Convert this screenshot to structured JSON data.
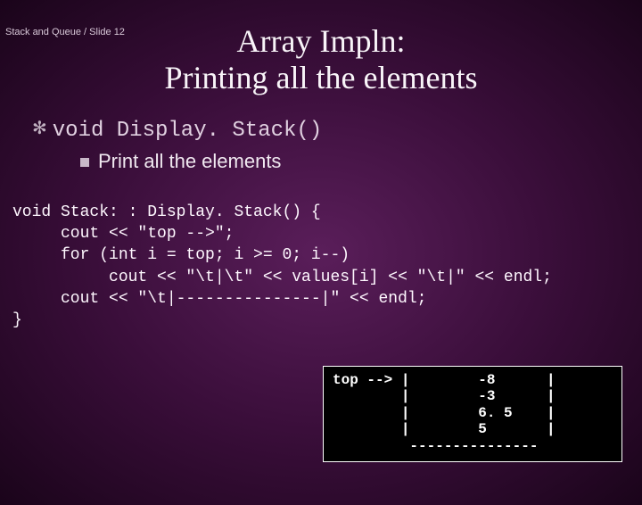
{
  "breadcrumb": "Stack and Queue / Slide 12",
  "title_line1": "Array Impln:",
  "title_line2": "Printing all the elements",
  "bullet": {
    "keyword": "void",
    "signature": " Display. Stack()"
  },
  "sub_bullet": "Print all the elements",
  "code": {
    "l1": "void Stack: : Display. Stack() {",
    "l2": "     cout << \"top -->\";",
    "l3": "     for (int i = top; i >= 0; i--)",
    "l4": "          cout << \"\\t|\\t\" << values[i] << \"\\t|\" << endl;",
    "l5": "     cout << \"\\t|---------------|\" << endl;",
    "l6": "}"
  },
  "terminal": {
    "r1": "top --> |        -8      |",
    "r2": "        |        -3      |",
    "r3": "        |        6. 5    |",
    "r4": "        |        5       |",
    "r5": "         ---------------"
  }
}
